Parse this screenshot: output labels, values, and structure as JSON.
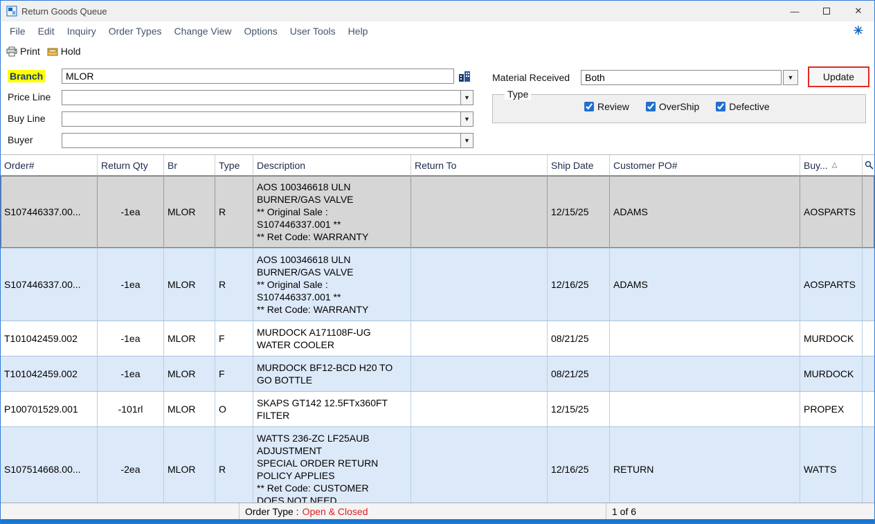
{
  "window": {
    "title": "Return Goods Queue"
  },
  "menu": {
    "items": [
      "File",
      "Edit",
      "Inquiry",
      "Order Types",
      "Change View",
      "Options",
      "User Tools",
      "Help"
    ]
  },
  "toolbar": {
    "print": "Print",
    "hold": "Hold"
  },
  "filters": {
    "branch_label": "Branch",
    "branch_value": "MLOR",
    "price_line_label": "Price Line",
    "price_line_value": "",
    "buy_line_label": "Buy Line",
    "buy_line_value": "",
    "buyer_label": "Buyer",
    "buyer_value": "",
    "material_received_label": "Material Received",
    "material_received_value": "Both",
    "update_label": "Update",
    "type_label": "Type",
    "type_checkboxes": [
      {
        "label": "Review",
        "checked": true
      },
      {
        "label": "OverShip",
        "checked": true
      },
      {
        "label": "Defective",
        "checked": true
      }
    ]
  },
  "table": {
    "columns": [
      "Order#",
      "Return Qty",
      "Br",
      "Type",
      "Description",
      "Return To",
      "Ship Date",
      "Customer PO#",
      "Buy..."
    ],
    "sort_indicator": "△",
    "rows": [
      {
        "order": "S107446337.00...",
        "qty": "-1ea",
        "br": "MLOR",
        "type": "R",
        "description": "AOS 100346618 ULN\nBURNER/GAS VALVE\n** Original Sale :\nS107446337.001 **\n** Ret Code: WARRANTY",
        "return_to": "",
        "ship_date": "12/15/25",
        "customer_po": "ADAMS",
        "buy": "AOSPARTS",
        "selected": true
      },
      {
        "order": "S107446337.00...",
        "qty": "-1ea",
        "br": "MLOR",
        "type": "R",
        "description": "AOS 100346618 ULN\nBURNER/GAS VALVE\n** Original Sale :\nS107446337.001 **\n** Ret Code: WARRANTY",
        "return_to": "",
        "ship_date": "12/16/25",
        "customer_po": "ADAMS",
        "buy": "AOSPARTS",
        "selected": false
      },
      {
        "order": "T101042459.002",
        "qty": "-1ea",
        "br": "MLOR",
        "type": "F",
        "description": "MURDOCK A171108F-UG\nWATER COOLER",
        "return_to": "",
        "ship_date": "08/21/25",
        "customer_po": "",
        "buy": "MURDOCK",
        "selected": false
      },
      {
        "order": "T101042459.002",
        "qty": "-1ea",
        "br": "MLOR",
        "type": "F",
        "description": "MURDOCK BF12-BCD H20 TO\nGO BOTTLE",
        "return_to": "",
        "ship_date": "08/21/25",
        "customer_po": "",
        "buy": "MURDOCK",
        "selected": false
      },
      {
        "order": "P100701529.001",
        "qty": "-101rl",
        "br": "MLOR",
        "type": "O",
        "description": "SKAPS GT142 12.5FTx360FT\nFILTER",
        "return_to": "",
        "ship_date": "12/15/25",
        "customer_po": "",
        "buy": "PROPEX",
        "selected": false
      },
      {
        "order": "S107514668.00...",
        "qty": "-2ea",
        "br": "MLOR",
        "type": "R",
        "description": "WATTS 236-ZC LF25AUB\nADJUSTMENT\nSPECIAL ORDER RETURN\nPOLICY APPLIES\n** Ret Code: CUSTOMER\nDOES NOT NEED",
        "return_to": "",
        "ship_date": "12/16/25",
        "customer_po": "RETURN",
        "buy": "WATTS",
        "selected": false
      }
    ]
  },
  "status": {
    "order_type_label": "Order Type :",
    "order_type_value": "Open & Closed",
    "position": "1 of 6"
  },
  "colors": {
    "accent_blue": "#1565c0",
    "highlight_yellow": "#ffff00",
    "update_border_red": "#e02b20",
    "alt_row_blue": "#dce9f8",
    "status_red": "#e02020"
  }
}
